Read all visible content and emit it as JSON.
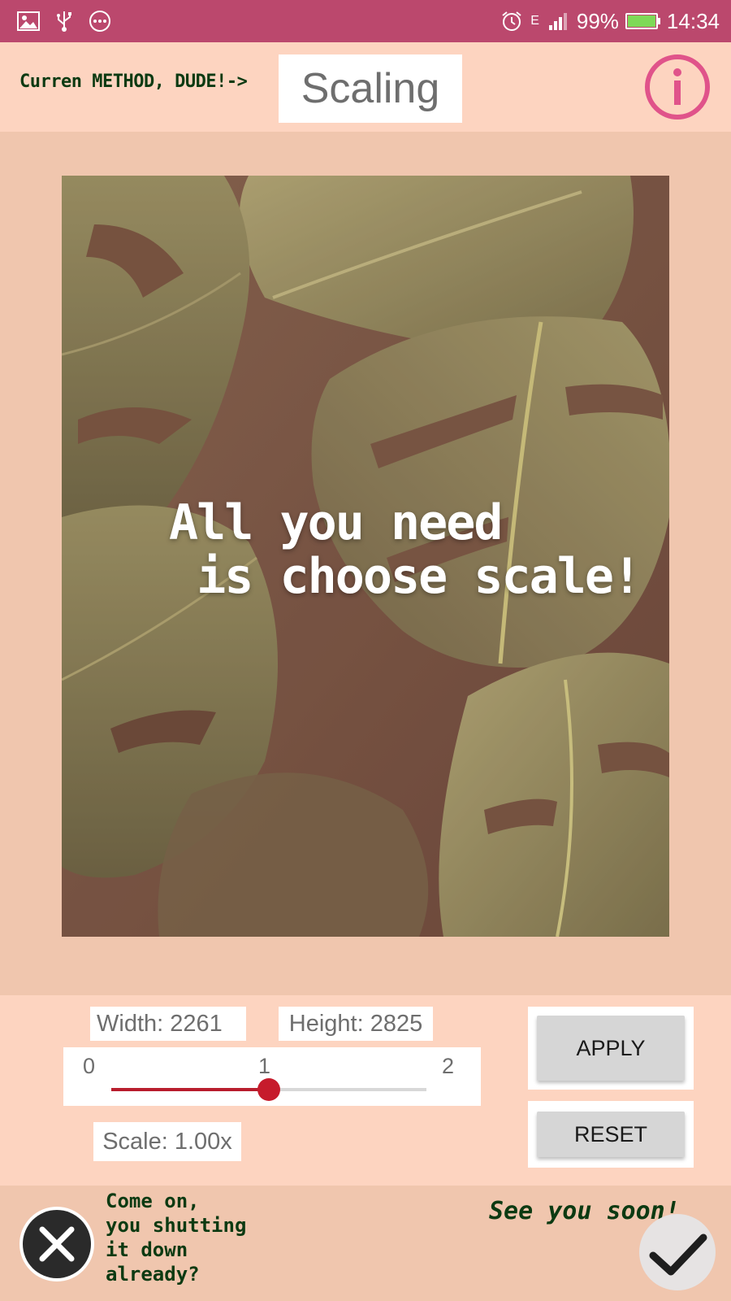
{
  "status_bar": {
    "left_icons": [
      "image-icon",
      "usb-icon",
      "more-icon"
    ],
    "right_icons": [
      "alarm-icon",
      "signal-icon",
      "battery-icon"
    ],
    "network": "E",
    "battery": "99%",
    "battery_level": 0.99,
    "time": "14:34",
    "color": "#bb486d"
  },
  "header": {
    "method_prefix": "Curren METHOD, DUDE!->",
    "method_value": "Scaling",
    "info_icon": "info-icon",
    "accent_color": "#e0538a"
  },
  "preview": {
    "overlay_text": "All you need\n is choose scale!"
  },
  "controls": {
    "width_label": "Width: 2261",
    "height_label": "Height: 2825",
    "slider": {
      "ticks": [
        "0",
        "1",
        "2"
      ],
      "min": 0,
      "max": 2,
      "value": 1.0,
      "color": "#c61b2c"
    },
    "scale_label": "Scale: 1.00x",
    "apply_label": "APPLY",
    "reset_label": "RESET"
  },
  "footer": {
    "quit_text": "Come on,\nyou shutting\nit down\nalready?",
    "goodbye_text": "See you soon!",
    "close_icon": "close-icon",
    "confirm_icon": "checkmark-icon"
  }
}
